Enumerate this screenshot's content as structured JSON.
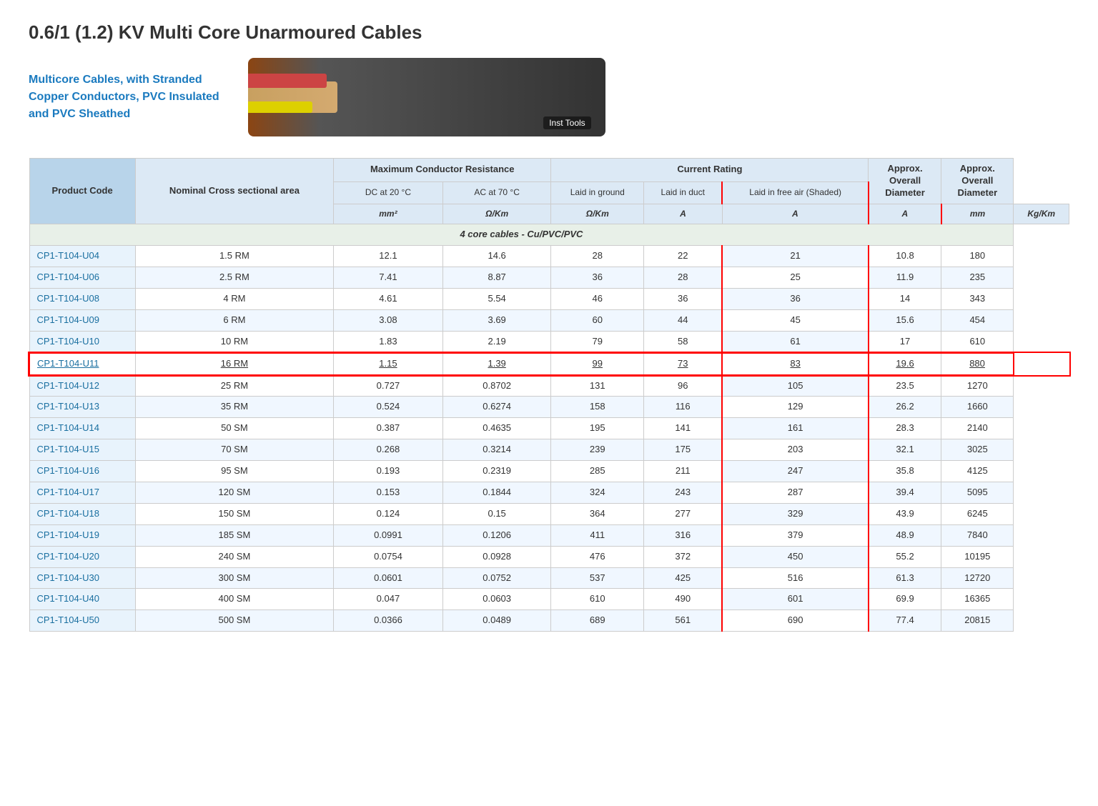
{
  "page": {
    "title_prefix": "0.6/1 (1.2) KV",
    "title_bold": "Multi Core Unarmoured Cables",
    "intro_text_line1": "Multicore Cables, with Stranded",
    "intro_text_line2": "Copper Conductors, PVC Insulated",
    "intro_text_line3": "and PVC Sheathed",
    "cable_label": "Inst Tools"
  },
  "table": {
    "headers": {
      "product_code": "Product Code",
      "nominal_cross": "Nominal Cross sectional area",
      "max_conductor": "Maximum Conductor Resistance",
      "current_rating": "Current Rating",
      "approx_diameter": "Approx. Overall Diameter",
      "approx_weight": "Approx. Overall Diameter",
      "dc_20": "DC at 20 °C",
      "ac_70": "AC at 70 °C",
      "laid_ground": "Laid in ground",
      "laid_duct": "Laid in duct",
      "laid_free": "Laid in free air (Shaded)"
    },
    "units": {
      "nominal": "mm²",
      "dc": "Ω/Km",
      "ac": "Ω/Km",
      "laid_ground": "A",
      "laid_duct": "A",
      "laid_free": "A",
      "diameter": "mm",
      "weight": "Kg/Km"
    },
    "section_label": "4 core cables - Cu/PVC/PVC",
    "rows": [
      {
        "code": "CP1-T104-U04",
        "nominal": "1.5 RM",
        "dc": "12.1",
        "ac": "14.6",
        "ground": "28",
        "duct": "22",
        "free": "21",
        "diameter": "10.8",
        "weight": "180",
        "highlighted": false
      },
      {
        "code": "CP1-T104-U06",
        "nominal": "2.5 RM",
        "dc": "7.41",
        "ac": "8.87",
        "ground": "36",
        "duct": "28",
        "free": "25",
        "diameter": "11.9",
        "weight": "235",
        "highlighted": false
      },
      {
        "code": "CP1-T104-U08",
        "nominal": "4 RM",
        "dc": "4.61",
        "ac": "5.54",
        "ground": "46",
        "duct": "36",
        "free": "36",
        "diameter": "14",
        "weight": "343",
        "highlighted": false
      },
      {
        "code": "CP1-T104-U09",
        "nominal": "6 RM",
        "dc": "3.08",
        "ac": "3.69",
        "ground": "60",
        "duct": "44",
        "free": "45",
        "diameter": "15.6",
        "weight": "454",
        "highlighted": false
      },
      {
        "code": "CP1-T104-U10",
        "nominal": "10 RM",
        "dc": "1.83",
        "ac": "2.19",
        "ground": "79",
        "duct": "58",
        "free": "61",
        "diameter": "17",
        "weight": "610",
        "highlighted": false
      },
      {
        "code": "CP1-T104-U11",
        "nominal": "16 RM",
        "dc": "1.15",
        "ac": "1.39",
        "ground": "99",
        "duct": "73",
        "free": "83",
        "diameter": "19.6",
        "weight": "880",
        "highlighted": true
      },
      {
        "code": "CP1-T104-U12",
        "nominal": "25 RM",
        "dc": "0.727",
        "ac": "0.8702",
        "ground": "131",
        "duct": "96",
        "free": "105",
        "diameter": "23.5",
        "weight": "1270",
        "highlighted": false
      },
      {
        "code": "CP1-T104-U13",
        "nominal": "35 RM",
        "dc": "0.524",
        "ac": "0.6274",
        "ground": "158",
        "duct": "116",
        "free": "129",
        "diameter": "26.2",
        "weight": "1660",
        "highlighted": false
      },
      {
        "code": "CP1-T104-U14",
        "nominal": "50 SM",
        "dc": "0.387",
        "ac": "0.4635",
        "ground": "195",
        "duct": "141",
        "free": "161",
        "diameter": "28.3",
        "weight": "2140",
        "highlighted": false
      },
      {
        "code": "CP1-T104-U15",
        "nominal": "70 SM",
        "dc": "0.268",
        "ac": "0.3214",
        "ground": "239",
        "duct": "175",
        "free": "203",
        "diameter": "32.1",
        "weight": "3025",
        "highlighted": false
      },
      {
        "code": "CP1-T104-U16",
        "nominal": "95 SM",
        "dc": "0.193",
        "ac": "0.2319",
        "ground": "285",
        "duct": "211",
        "free": "247",
        "diameter": "35.8",
        "weight": "4125",
        "highlighted": false
      },
      {
        "code": "CP1-T104-U17",
        "nominal": "120 SM",
        "dc": "0.153",
        "ac": "0.1844",
        "ground": "324",
        "duct": "243",
        "free": "287",
        "diameter": "39.4",
        "weight": "5095",
        "highlighted": false
      },
      {
        "code": "CP1-T104-U18",
        "nominal": "150 SM",
        "dc": "0.124",
        "ac": "0.15",
        "ground": "364",
        "duct": "277",
        "free": "329",
        "diameter": "43.9",
        "weight": "6245",
        "highlighted": false
      },
      {
        "code": "CP1-T104-U19",
        "nominal": "185 SM",
        "dc": "0.0991",
        "ac": "0.1206",
        "ground": "411",
        "duct": "316",
        "free": "379",
        "diameter": "48.9",
        "weight": "7840",
        "highlighted": false
      },
      {
        "code": "CP1-T104-U20",
        "nominal": "240 SM",
        "dc": "0.0754",
        "ac": "0.0928",
        "ground": "476",
        "duct": "372",
        "free": "450",
        "diameter": "55.2",
        "weight": "10195",
        "highlighted": false
      },
      {
        "code": "CP1-T104-U30",
        "nominal": "300 SM",
        "dc": "0.0601",
        "ac": "0.0752",
        "ground": "537",
        "duct": "425",
        "free": "516",
        "diameter": "61.3",
        "weight": "12720",
        "highlighted": false
      },
      {
        "code": "CP1-T104-U40",
        "nominal": "400 SM",
        "dc": "0.047",
        "ac": "0.0603",
        "ground": "610",
        "duct": "490",
        "free": "601",
        "diameter": "69.9",
        "weight": "16365",
        "highlighted": false
      },
      {
        "code": "CP1-T104-U50",
        "nominal": "500 SM",
        "dc": "0.0366",
        "ac": "0.0489",
        "ground": "689",
        "duct": "561",
        "free": "690",
        "diameter": "77.4",
        "weight": "20815",
        "highlighted": false
      }
    ]
  }
}
